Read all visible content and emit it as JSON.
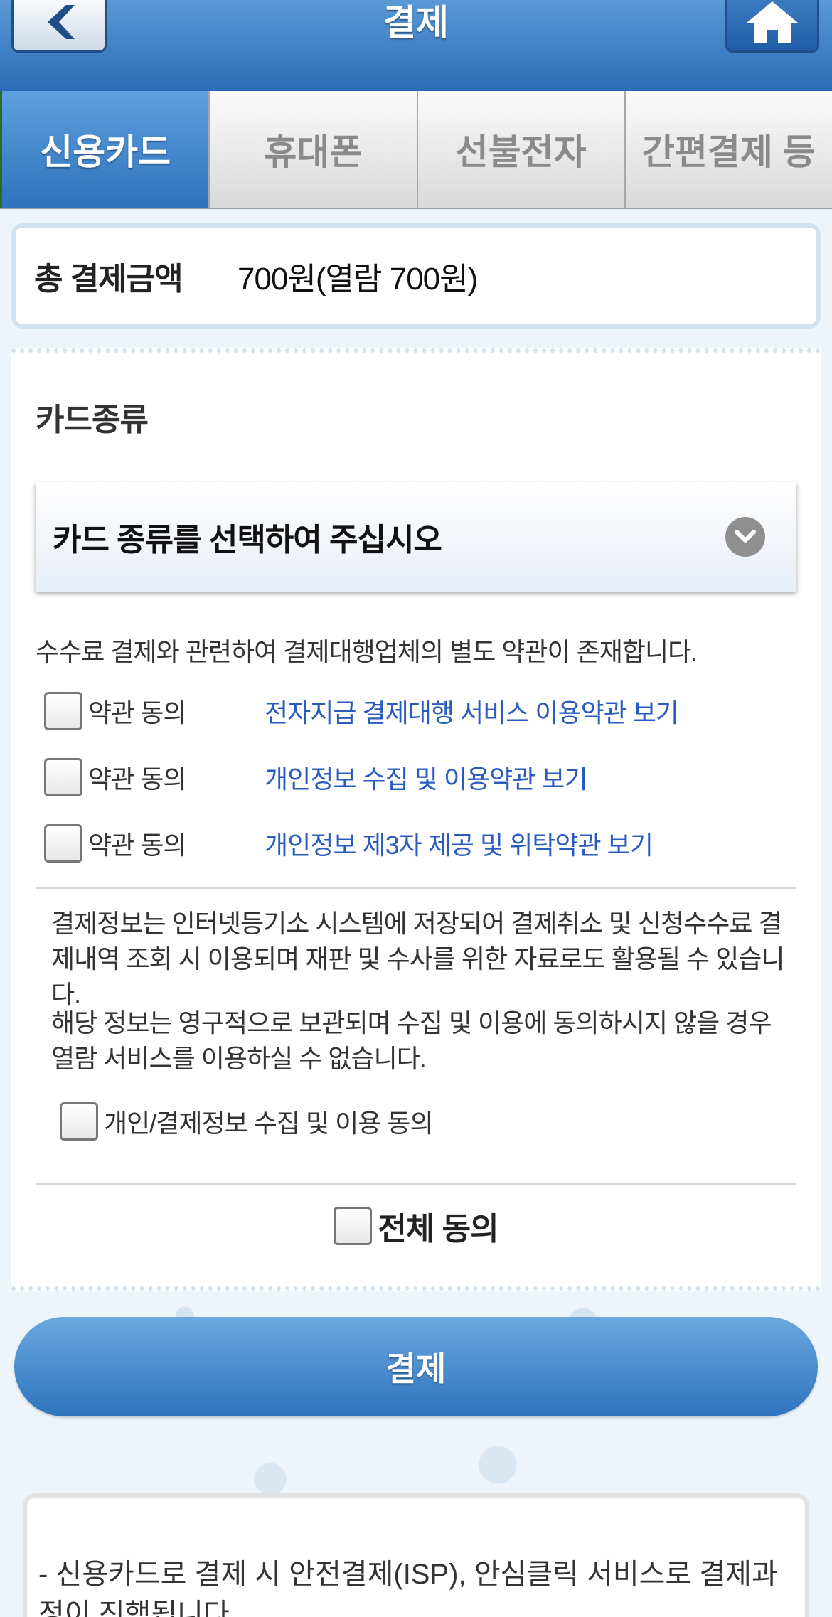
{
  "header": {
    "title": "결제"
  },
  "tabs": [
    {
      "label": "신용카드",
      "active": true
    },
    {
      "label": "휴대폰",
      "active": false
    },
    {
      "label": "선불전자",
      "active": false
    },
    {
      "label": "간편결제 등",
      "active": false
    }
  ],
  "amount": {
    "label": "총 결제금액",
    "value": "700원(열람 700원)"
  },
  "card": {
    "section_label": "카드종류",
    "select_placeholder": "카드 종류를 선택하여 주십시오"
  },
  "notice": "수수료 결제와 관련하여 결제대행업체의 별도 약관이 존재합니다.",
  "terms": [
    {
      "agree_label": "약관 동의",
      "link": "전자지급 결제대행 서비스 이용약관 보기",
      "checked": false
    },
    {
      "agree_label": "약관 동의",
      "link": "개인정보 수집 및 이용약관 보기",
      "checked": false
    },
    {
      "agree_label": "약관 동의",
      "link": "개인정보 제3자 제공 및 위탁약관 보기",
      "checked": false
    }
  ],
  "info": {
    "paragraph1": "결제정보는 인터넷등기소 시스템에 저장되어 결제취소 및 신청수수료 결제내역 조회 시 이용되며 재판 및 수사를 위한 자료로도 활용될 수 있습니다.",
    "paragraph2": "해당 정보는 영구적으로 보관되며 수집 및 이용에 동의하시지 않을 경우 열람 서비스를 이용하실 수 없습니다."
  },
  "personal_consent": "개인/결제정보 수집 및 이용 동의",
  "all_agree": "전체 동의",
  "pay_button": "결제",
  "bottom_note": "- 신용카드로 결제 시 안전결제(ISP), 안심클릭 서비스로 결제과정이 진행됩니다.",
  "colors": {
    "brand_blue": "#2f72bd",
    "link_blue": "#2a5bbf"
  }
}
